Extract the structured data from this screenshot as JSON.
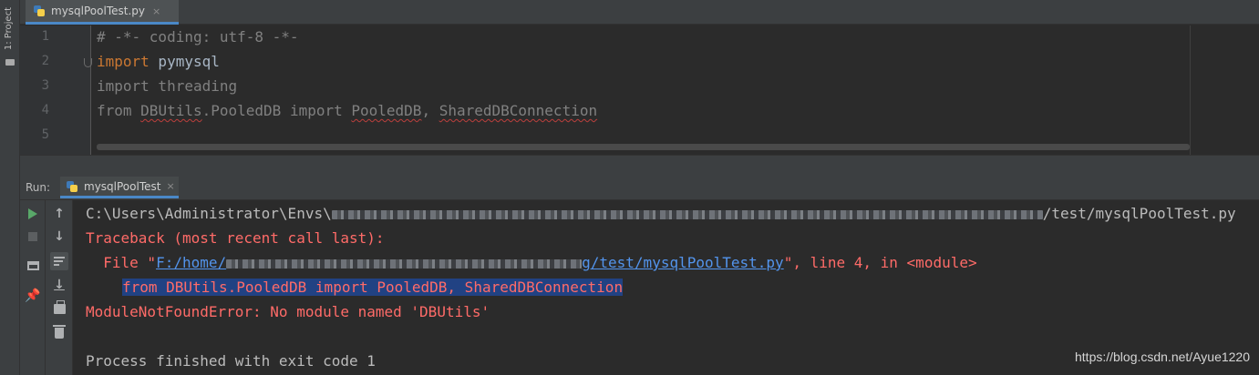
{
  "sidebar": {
    "project_label": "1: Project",
    "folder_icon": "folder-icon"
  },
  "editor": {
    "tab": {
      "label": "mysqlPoolTest.py",
      "close": "×",
      "icon": "python-file-icon"
    },
    "line_numbers": [
      "1",
      "2",
      "3",
      "4",
      "5"
    ],
    "lines": {
      "l1": "# -*- coding: utf-8 -*-",
      "l2_kw": "import",
      "l2_rest": " pymysql",
      "l3": "import threading",
      "l4_a": "from ",
      "l4_b": "DBUtils",
      "l4_c": ".PooledDB import ",
      "l4_d": "PooledDB",
      "l4_e": ", ",
      "l4_f": "SharedDBConnection"
    }
  },
  "run": {
    "title": "Run:",
    "tab": {
      "label": "mysqlPoolTest",
      "close": "×",
      "icon": "python-run-icon"
    },
    "toolbar_icons": [
      "run-icon",
      "stop-icon",
      "layout-icon",
      "pin-icon",
      "arrow-up-icon",
      "arrow-down-icon",
      "soft-wrap-icon",
      "scroll-to-end-icon",
      "print-icon",
      "trash-icon"
    ],
    "console": {
      "cmd_prefix": "C:\\Users\\Administrator\\Envs\\",
      "cmd_suffix": "/test/mysqlPoolTest.py",
      "traceback": "Traceback (most recent call last):",
      "file_prefix": "  File \"",
      "file_link_a": "F:/home/",
      "file_link_b": "g/test/mysqlPoolTest.py",
      "file_suffix": "\", line 4, in <module>",
      "code_line": "from DBUtils.PooledDB import PooledDB, SharedDBConnection",
      "error": "ModuleNotFoundError: No module named 'DBUtils'",
      "exit": "Process finished with exit code 1"
    },
    "watermark": "https://blog.csdn.net/Ayue1220"
  }
}
